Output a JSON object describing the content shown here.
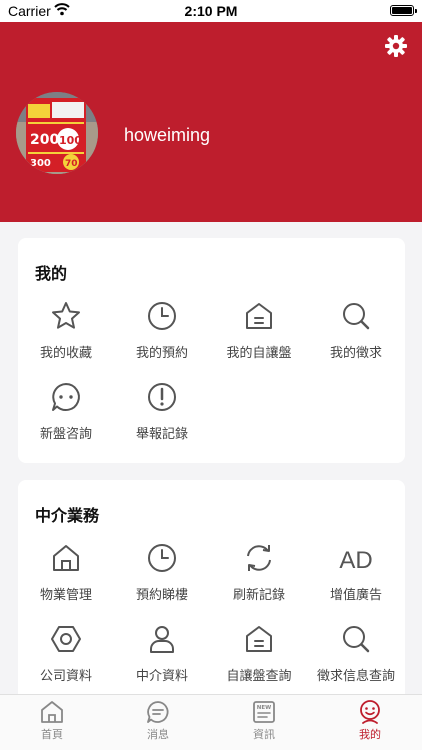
{
  "status_bar": {
    "carrier": "Carrier",
    "time": "2:10 PM"
  },
  "profile": {
    "username": "howeiming",
    "avatar_poster_text": [
      "200",
      "100",
      "300",
      "70"
    ]
  },
  "my_section": {
    "title": "我的",
    "items": [
      {
        "label": "我的收藏",
        "icon": "star-icon"
      },
      {
        "label": "我的預約",
        "icon": "clock-icon"
      },
      {
        "label": "我的自讓盤",
        "icon": "house-icon"
      },
      {
        "label": "我的徵求",
        "icon": "search-icon"
      },
      {
        "label": "新盤咨詢",
        "icon": "chat-bubble-icon"
      },
      {
        "label": "舉報記錄",
        "icon": "alert-icon"
      }
    ]
  },
  "agent_section": {
    "title": "中介業務",
    "items": [
      {
        "label": "物業管理",
        "icon": "home-outline-icon"
      },
      {
        "label": "預約睇樓",
        "icon": "clock-icon"
      },
      {
        "label": "刷新記錄",
        "icon": "refresh-icon"
      },
      {
        "label": "增值廣告",
        "icon": "ad-icon",
        "icon_text": "AD"
      },
      {
        "label": "公司資料",
        "icon": "hexagon-nut-icon"
      },
      {
        "label": "中介資料",
        "icon": "person-icon"
      },
      {
        "label": "自讓盤查詢",
        "icon": "house-icon"
      },
      {
        "label": "徵求信息查詢",
        "icon": "search-icon"
      }
    ]
  },
  "tabbar": {
    "items": [
      {
        "label": "首頁",
        "icon": "home-icon"
      },
      {
        "label": "消息",
        "icon": "message-icon"
      },
      {
        "label": "資訊",
        "icon": "news-icon",
        "icon_text": "NEW"
      },
      {
        "label": "我的",
        "icon": "profile-smile-icon"
      }
    ],
    "active_index": 3
  },
  "colors": {
    "brand": "#be1e2d",
    "icon": "#555555",
    "tab_inactive": "#888888",
    "background": "#f4f4f6"
  }
}
